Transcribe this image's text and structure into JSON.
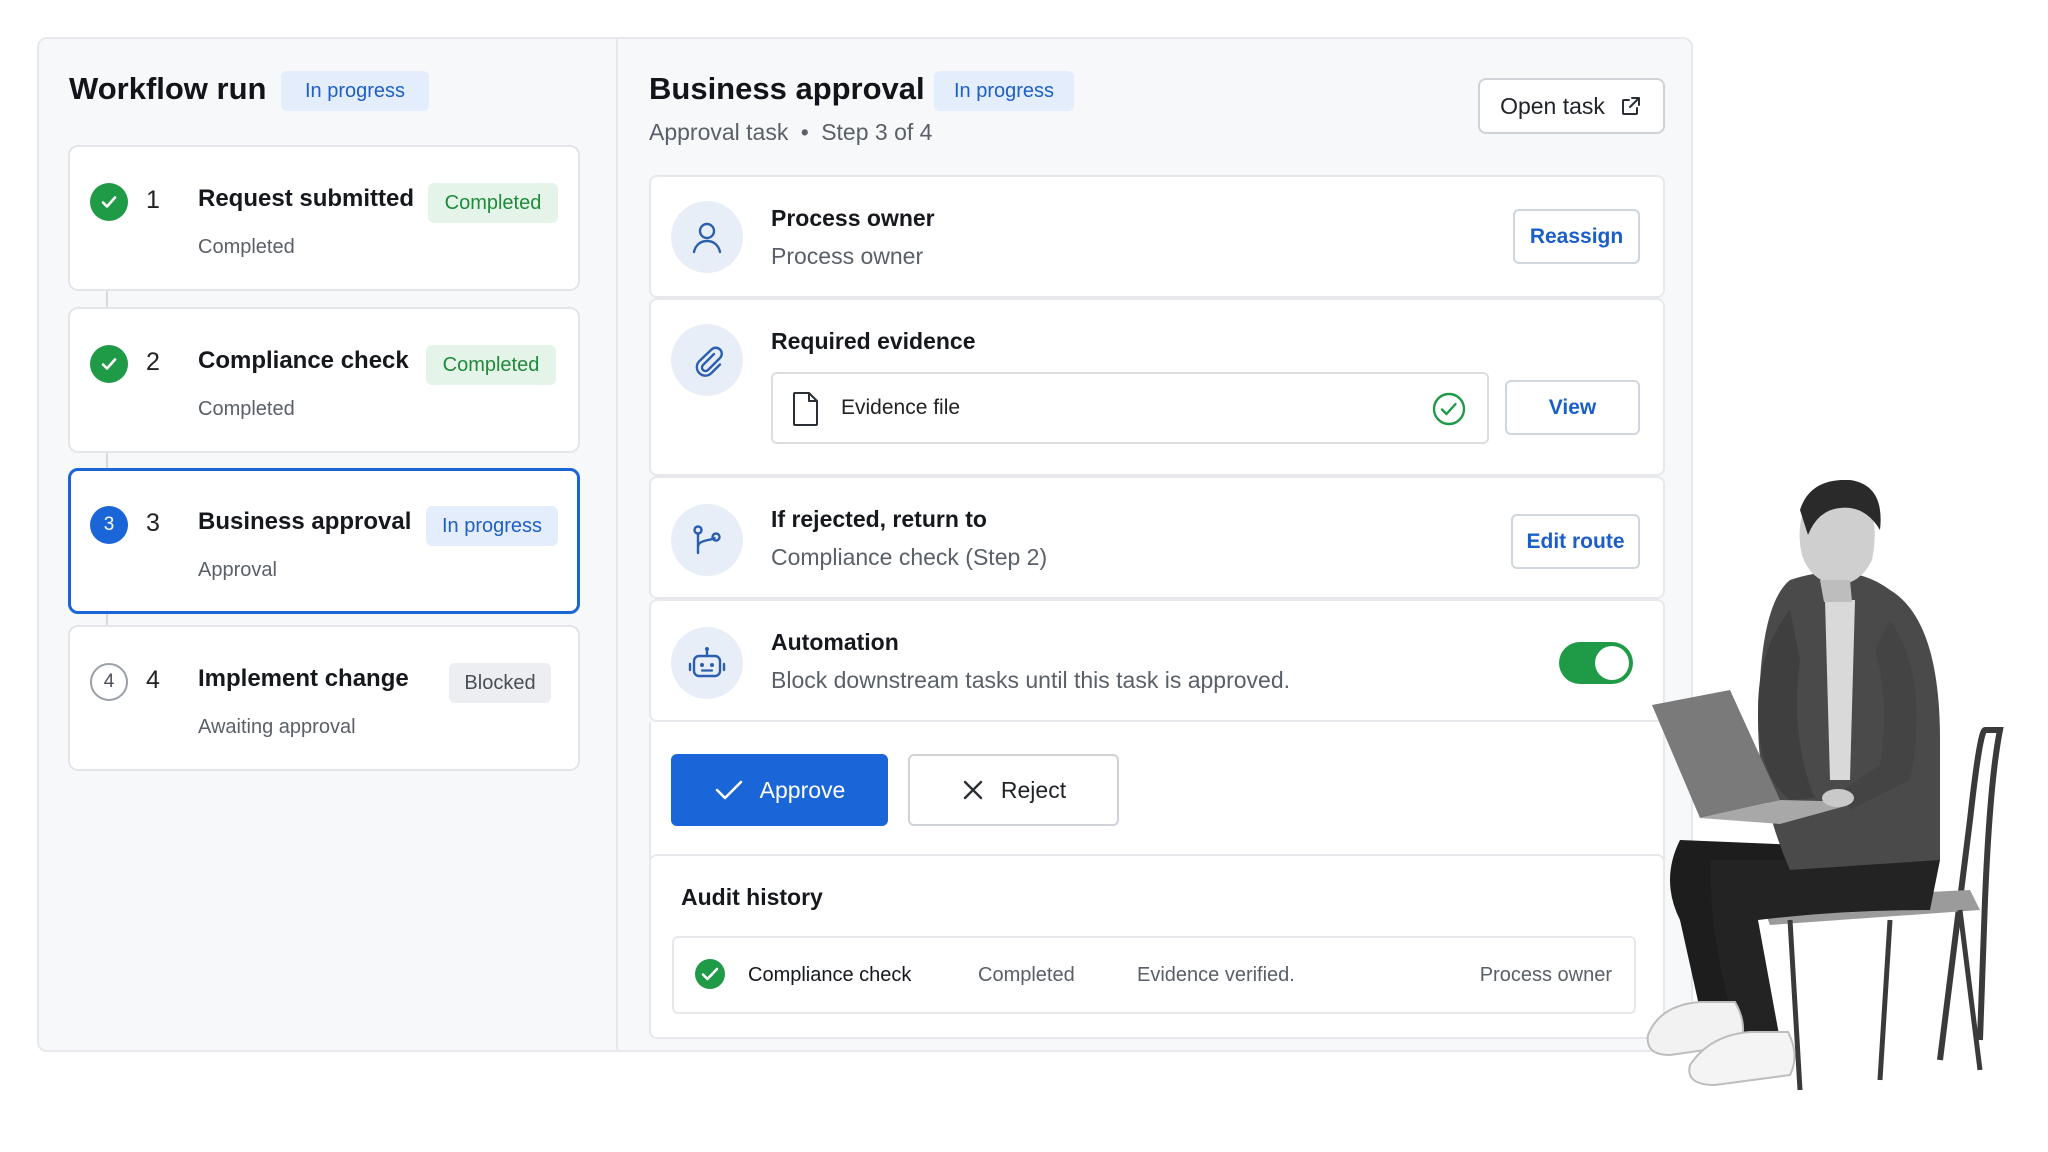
{
  "workflow": {
    "title": "Workflow run",
    "status": "In progress",
    "steps": [
      {
        "number": "1",
        "name": "Request submitted",
        "badge": "Completed",
        "sub": "Completed",
        "state": "done"
      },
      {
        "number": "2",
        "name": "Compliance check",
        "badge": "Completed",
        "sub": "Completed",
        "state": "done"
      },
      {
        "number": "3",
        "name": "Business approval",
        "badge": "In progress",
        "sub": "Approval",
        "state": "current"
      },
      {
        "number": "4",
        "name": "Implement change",
        "badge": "Blocked",
        "sub": "Awaiting approval",
        "state": "pending"
      }
    ]
  },
  "task": {
    "title": "Business approval",
    "status": "In progress",
    "type": "Approval task",
    "separator": "•",
    "step": "Step 3 of 4",
    "open_label": "Open task"
  },
  "owner": {
    "heading": "Process owner",
    "value": "Process owner",
    "action": "Reassign"
  },
  "evidence": {
    "heading": "Required evidence",
    "file": "Evidence file",
    "action": "View"
  },
  "route": {
    "heading": "If rejected, return to",
    "value": "Compliance check (Step 2)",
    "action": "Edit route"
  },
  "automation": {
    "heading": "Automation",
    "value": "Block downstream tasks until this task is approved.",
    "enabled": true
  },
  "actions": {
    "approve": "Approve",
    "reject": "Reject"
  },
  "audit": {
    "title": "Audit history",
    "rows": [
      {
        "step": "Compliance check",
        "status": "Completed",
        "note": "Evidence verified.",
        "actor": "Process owner"
      }
    ]
  },
  "colors": {
    "accent": "#1a65d8",
    "success": "#1f9a46",
    "border": "#e6e8eb"
  }
}
